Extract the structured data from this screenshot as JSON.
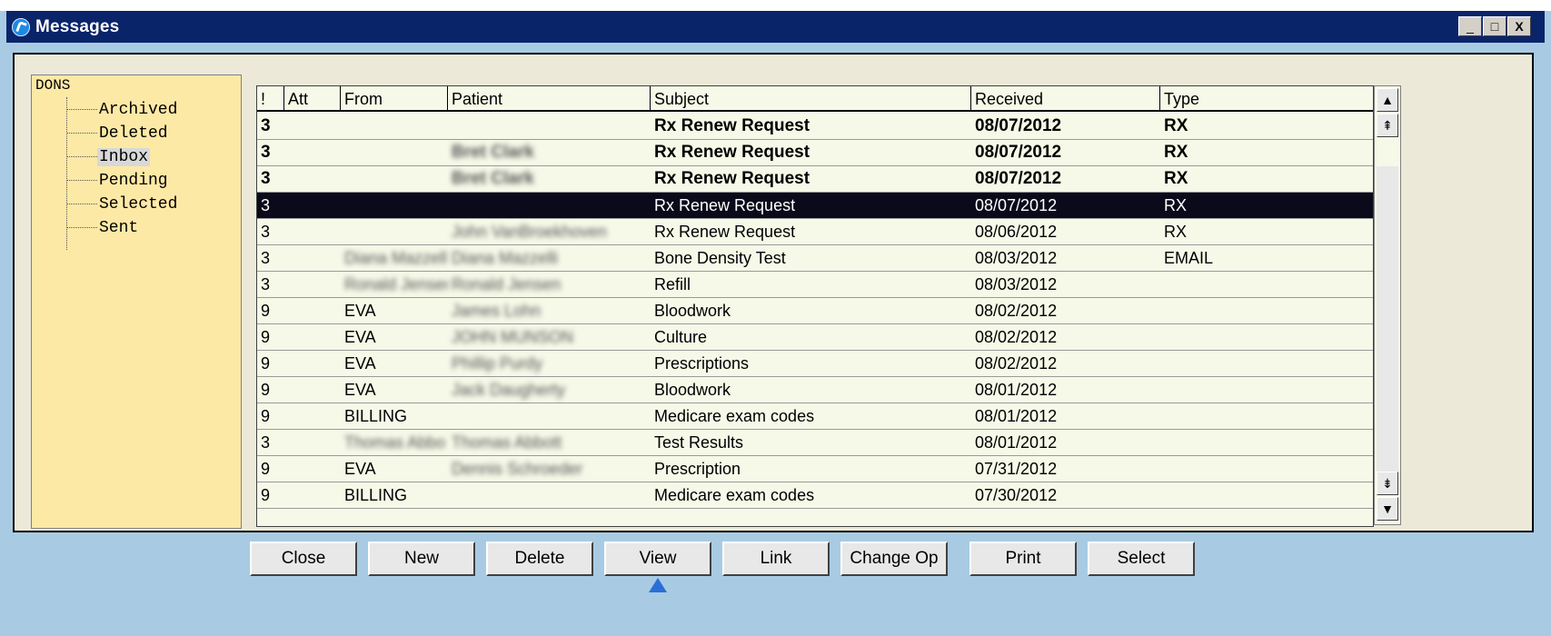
{
  "window": {
    "title": "Messages",
    "minimize": "_",
    "maximize": "□",
    "close": "X"
  },
  "tree": {
    "root": "DONS",
    "items": [
      "Archived",
      "Deleted",
      "Inbox",
      "Pending",
      "Selected",
      "Sent"
    ],
    "selected": "Inbox"
  },
  "grid": {
    "columns": [
      "!",
      "Att",
      "From",
      "Patient",
      "Subject",
      "Received",
      "Type"
    ],
    "rows": [
      {
        "priority": "3",
        "att": "",
        "from": "",
        "patient": "",
        "subject": "Rx Renew Request",
        "received": "08/07/2012",
        "type": "RX",
        "bold": true
      },
      {
        "priority": "3",
        "att": "",
        "from": "",
        "patient": "Bret Clark",
        "subject": "Rx Renew Request",
        "received": "08/07/2012",
        "type": "RX",
        "bold": true
      },
      {
        "priority": "3",
        "att": "",
        "from": "",
        "patient": "Bret Clark",
        "subject": "Rx Renew Request",
        "received": "08/07/2012",
        "type": "RX",
        "bold": true
      },
      {
        "priority": "3",
        "att": "",
        "from": "",
        "patient": "",
        "subject": "Rx Renew Request",
        "received": "08/07/2012",
        "type": "RX",
        "selected": true
      },
      {
        "priority": "3",
        "att": "",
        "from": "",
        "patient": "John VanBroekhoven",
        "subject": "Rx Renew Request",
        "received": "08/06/2012",
        "type": "RX"
      },
      {
        "priority": "3",
        "att": "",
        "from": "Diana Mazzell",
        "patient": "Diana Mazzelli",
        "subject": "Bone Density Test",
        "received": "08/03/2012",
        "type": "EMAIL"
      },
      {
        "priority": "3",
        "att": "",
        "from": "Ronald Jensen",
        "patient": "Ronald Jensen",
        "subject": "Refill",
        "received": "08/03/2012",
        "type": ""
      },
      {
        "priority": "9",
        "att": "",
        "from": "EVA",
        "patient": "James Lohn",
        "subject": "Bloodwork",
        "received": "08/02/2012",
        "type": ""
      },
      {
        "priority": "9",
        "att": "",
        "from": "EVA",
        "patient": "JOHN MUNSON",
        "subject": "Culture",
        "received": "08/02/2012",
        "type": ""
      },
      {
        "priority": "9",
        "att": "",
        "from": "EVA",
        "patient": "Phillip Purdy",
        "subject": "Prescriptions",
        "received": "08/02/2012",
        "type": ""
      },
      {
        "priority": "9",
        "att": "",
        "from": "EVA",
        "patient": "Jack Daugherty",
        "subject": "Bloodwork",
        "received": "08/01/2012",
        "type": ""
      },
      {
        "priority": "9",
        "att": "",
        "from": "BILLING",
        "patient": "",
        "subject": "Medicare exam codes",
        "received": "08/01/2012",
        "type": ""
      },
      {
        "priority": "3",
        "att": "",
        "from": "Thomas Abbo",
        "patient": "Thomas Abbott",
        "subject": "Test Results",
        "received": "08/01/2012",
        "type": ""
      },
      {
        "priority": "9",
        "att": "",
        "from": "EVA",
        "patient": "Dennis Schroeder",
        "subject": "Prescription",
        "received": "07/31/2012",
        "type": ""
      },
      {
        "priority": "9",
        "att": "",
        "from": "BILLING",
        "patient": "",
        "subject": "Medicare exam codes",
        "received": "07/30/2012",
        "type": ""
      }
    ]
  },
  "scrollbar": {
    "up": "▲",
    "page_up": "⇞",
    "page_down": "⇟",
    "down": "▼"
  },
  "buttons": [
    "Close",
    "New",
    "Delete",
    "View",
    "Link",
    "Change Op",
    "Print",
    "Select"
  ]
}
